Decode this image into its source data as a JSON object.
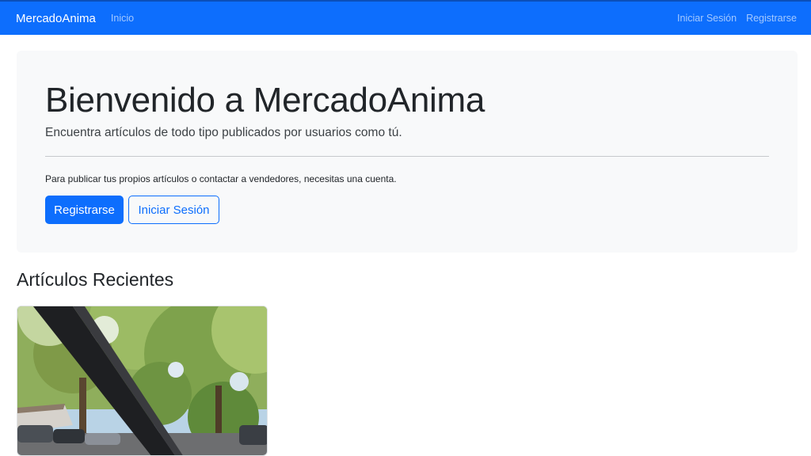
{
  "navbar": {
    "brand": "MercadoAnima",
    "links_left": [
      "Inicio"
    ],
    "links_right": [
      "Iniciar Sesión",
      "Registrarse"
    ],
    "bg_color": "#0d6efd"
  },
  "hero": {
    "title": "Bienvenido a MercadoAnima",
    "lead": "Encuentra artículos de todo tipo publicados por usuarios como tú.",
    "note": "Para publicar tus propios artículos o contactar a vendedores, necesitas una cuenta.",
    "primary_button": "Registrarse",
    "secondary_button": "Iniciar Sesión"
  },
  "recent": {
    "title": "Artículos Recientes",
    "items": [
      {
        "image_desc": "car-window-trees-photo"
      }
    ]
  }
}
